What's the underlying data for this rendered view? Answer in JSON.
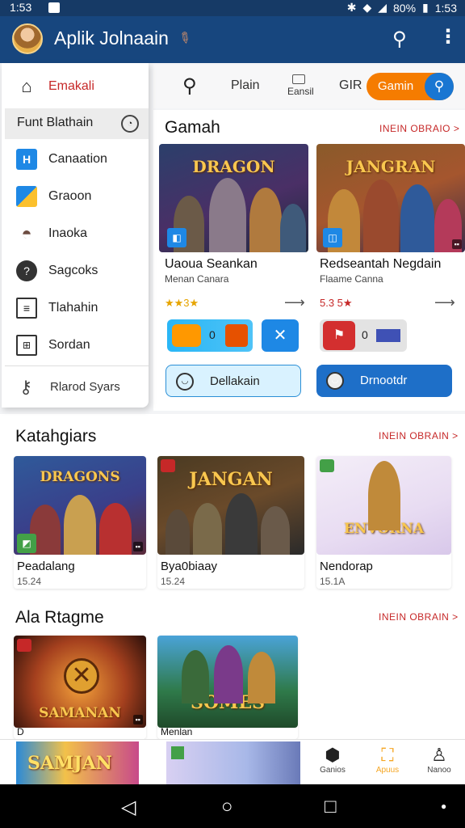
{
  "status": {
    "time": "1:53",
    "battery": "80%",
    "clock": "1:53"
  },
  "appbar": {
    "title": "Aplik Jolnaain"
  },
  "drawer": {
    "home": "Emakali",
    "section": "Funt Blathain",
    "items": [
      {
        "label": "Canaation",
        "icon": "grid-icon",
        "color": "#1e88e5"
      },
      {
        "label": "Graoon",
        "icon": "folder-icon",
        "color": "#fbc02d"
      },
      {
        "label": "Inaoka",
        "icon": "bowl-icon",
        "color": "#6d4c41"
      },
      {
        "label": "Sagcoks",
        "icon": "chat-icon",
        "color": "#333333"
      },
      {
        "label": "Tlahahin",
        "icon": "list-icon",
        "color": "#333333"
      },
      {
        "label": "Sordan",
        "icon": "book-icon",
        "color": "#333333"
      }
    ],
    "settings": "Rlarod Syars"
  },
  "toolbar": {
    "plain": "Plain",
    "badge": "Eansil",
    "gr": "GIR",
    "pill": "Gamin"
  },
  "featured": {
    "title": "Gamah",
    "link": "INEIN OBRAIO >",
    "games": [
      {
        "title": "Uaoua Seankan",
        "sub": "Menan Canara",
        "rating": "★★3★",
        "art": "DRAGON"
      },
      {
        "title": "Redseantah Negdain",
        "sub": "Flaame Canna",
        "rating": "5.3 5★",
        "art": "JANGRAN"
      }
    ],
    "btn1": "Dellakain",
    "btn2": "Drnootdr",
    "chip1_num": "0",
    "chip2_num": "0"
  },
  "categories": {
    "title": "Katahgiars",
    "link": "INEIN OBRAIN >",
    "items": [
      {
        "name": "Peadalang",
        "meta": "15.24",
        "art": "DRAGONS"
      },
      {
        "name": "Bya0biaay",
        "meta": "15.24",
        "art": "JANGAN"
      },
      {
        "name": "Nendorap",
        "meta": "15.1A",
        "art": "ENVORNA"
      }
    ]
  },
  "third": {
    "title": "Ala Rtagme",
    "link": "INEIN OBRAIN >",
    "items": [
      {
        "name": "D",
        "art": "SAMANAN"
      },
      {
        "name": "Menlan",
        "art": "SOMES"
      }
    ]
  },
  "bottomnav": [
    {
      "label": "Ganios"
    },
    {
      "label": "Apuus"
    },
    {
      "label": "Nanoo"
    }
  ],
  "bottom_teaser": "SAMJAN",
  "colors": {
    "appbar": "#17467e",
    "accent": "#f57c00",
    "primary": "#1976d2",
    "link": "#c62828"
  }
}
